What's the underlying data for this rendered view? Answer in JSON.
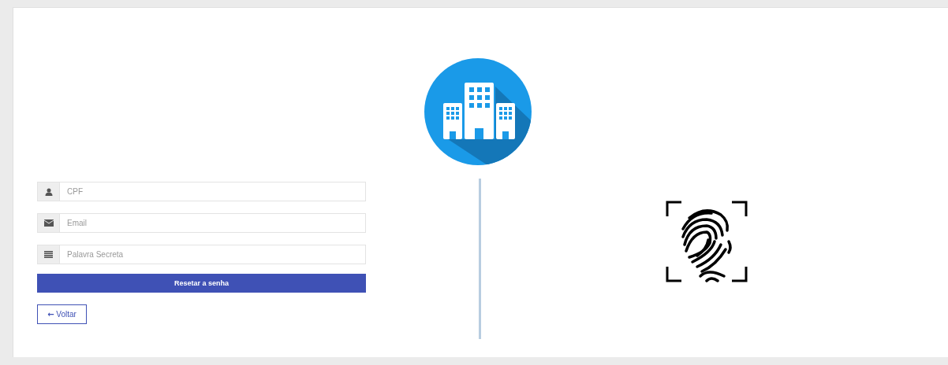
{
  "fields": [
    {
      "kind": "user",
      "placeholder": "CPF"
    },
    {
      "kind": "mail",
      "placeholder": "Email"
    },
    {
      "kind": "lines",
      "placeholder": "Palavra Secreta"
    }
  ],
  "submit": {
    "label": "Resetar a senha"
  },
  "back": {
    "arrow": "←",
    "label": "Voltar"
  }
}
